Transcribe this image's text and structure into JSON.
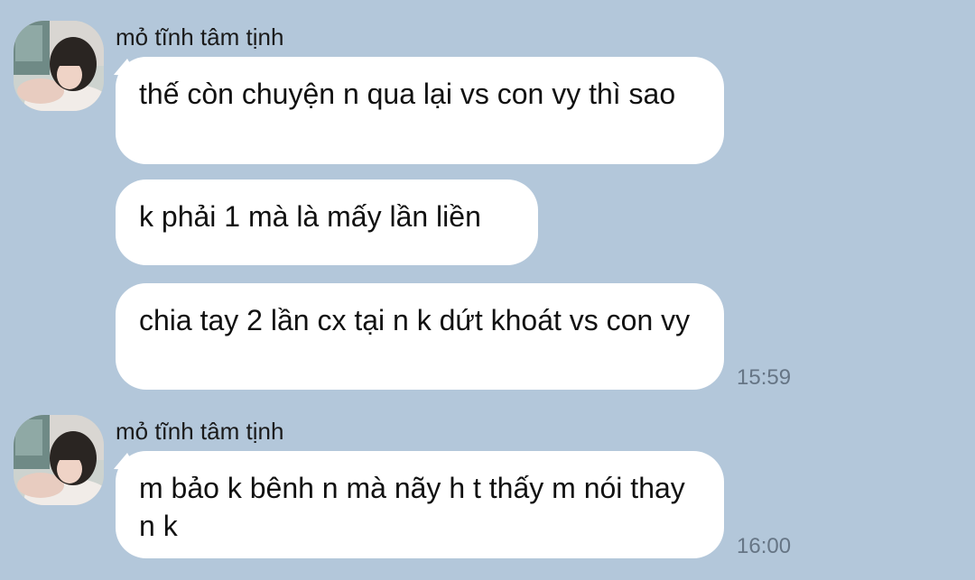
{
  "groups": [
    {
      "sender": "mỏ tĩnh tâm tịnh",
      "avatar_icon": "user-photo-avatar",
      "messages": [
        {
          "text": "thế còn chuyện n qua lại vs con vy thì sao"
        },
        {
          "text": "k phải 1 mà là mấy lần liền"
        },
        {
          "text": "chia tay 2 lần cx tại n k dứt khoát vs con vy",
          "time": "15:59"
        }
      ]
    },
    {
      "sender": "mỏ tĩnh tâm tịnh",
      "avatar_icon": "user-photo-avatar",
      "messages": [
        {
          "text": "m bảo k bênh n mà nãy h t thấy m nói thay n k",
          "time": "16:00"
        }
      ]
    }
  ],
  "colors": {
    "background": "#b3c7da",
    "bubble": "#ffffff",
    "text": "#111111",
    "timestamp": "#667585"
  }
}
